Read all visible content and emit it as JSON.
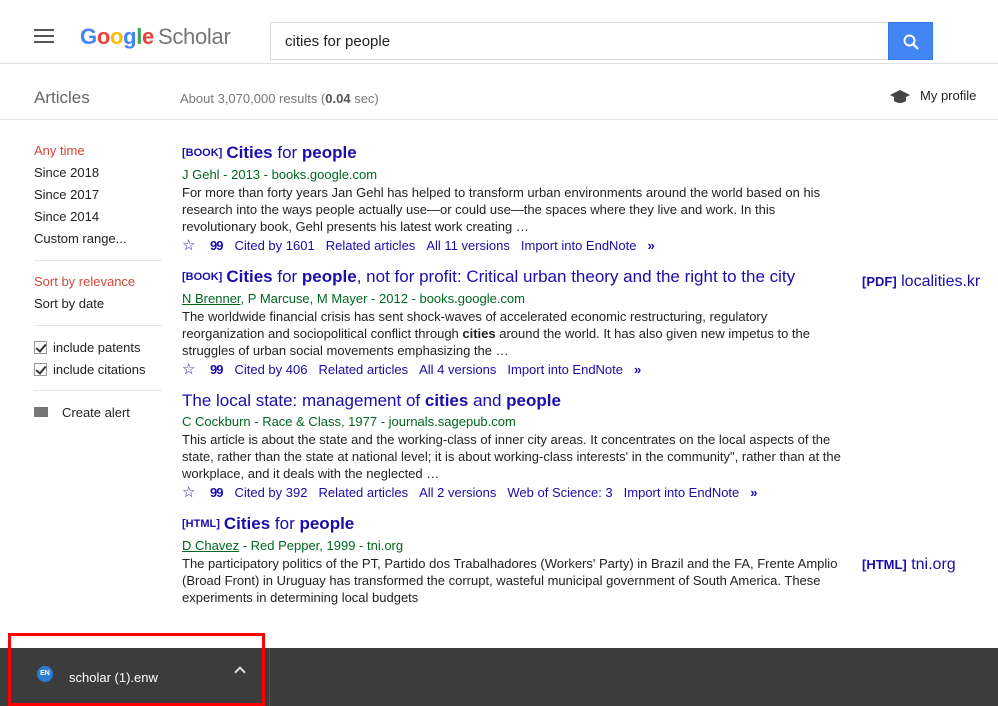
{
  "header": {
    "logo_google": "Google",
    "logo_scholar": "Scholar",
    "search_value": "cities for people"
  },
  "subheader": {
    "section_title": "Articles",
    "results_prefix": "About 3,070,000 results (",
    "results_time": "0.04",
    "results_suffix": " sec)",
    "profile_label": "My profile"
  },
  "sidebar": {
    "time_filters": [
      "Any time",
      "Since 2018",
      "Since 2017",
      "Since 2014",
      "Custom range..."
    ],
    "sort_options": [
      "Sort by relevance",
      "Sort by date"
    ],
    "include_patents": "include patents",
    "include_citations": "include citations",
    "create_alert": "Create alert"
  },
  "results": [
    {
      "tag": "[BOOK]",
      "title_parts": [
        "Cities",
        " for ",
        "people",
        ""
      ],
      "authors": "J Gehl - 2013 - books.google.com",
      "snippet": "For more than forty years Jan Gehl has helped to transform urban environments around the world based on his research into the ways people actually use—or could use—the spaces where they live and work. In this revolutionary book, Gehl presents his latest work creating …",
      "cited_by": "Cited by 1601",
      "related": "Related articles",
      "versions": "All 11 versions",
      "import": "Import into EndNote"
    },
    {
      "tag": "[BOOK]",
      "title_parts": [
        "Cities",
        " for ",
        "people",
        ", not for profit: Critical urban theory and the right to the city"
      ],
      "authors_link": "N Brenner",
      "authors": ", P Marcuse, M Mayer - 2012 - books.google.com",
      "snippet_a": "The worldwide financial crisis has sent shock-waves of accelerated economic restructuring, regulatory reorganization and sociopolitical conflict through ",
      "snippet_b": "cities",
      "snippet_c": " around the world. It has also given new impetus to the struggles of urban social movements emphasizing the …",
      "cited_by": "Cited by 406",
      "related": "Related articles",
      "versions": "All 4 versions",
      "import": "Import into EndNote"
    },
    {
      "title_a": "The local state: management of ",
      "title_b": "cities",
      "title_c": " and ",
      "title_d": "people",
      "authors": "C Cockburn - Race & Class, 1977 - journals.sagepub.com",
      "snippet": "This article is about the state and the working-class of inner city areas. It concentrates on the local aspects of the state, rather than the state at national level; it is about working-class interests' in the community\", rather than at the workplace, and it deals with the neglected …",
      "cited_by": "Cited by 392",
      "related": "Related articles",
      "versions": "All 2 versions",
      "wos": "Web of Science: 3",
      "import": "Import into EndNote"
    },
    {
      "tag": "[HTML]",
      "title_parts": [
        "Cities",
        " for ",
        "people",
        ""
      ],
      "authors_link": "D Chavez",
      "authors": " - Red Pepper, 1999 - tni.org",
      "snippet": "The participatory politics of the PT, Partido dos Trabalhadores (Workers' Party) in Brazil and the FA, Frente Amplio (Broad Front) in Uruguay has transformed the corrupt, wasteful municipal government of South America. These experiments in determining local budgets"
    }
  ],
  "side_links": [
    {
      "tag": "[PDF]",
      "label": " localities.kr"
    },
    {
      "tag": "[HTML]",
      "label": " tni.org"
    }
  ],
  "download": {
    "file_name": "scholar (1).enw",
    "icon_text": "EN"
  }
}
